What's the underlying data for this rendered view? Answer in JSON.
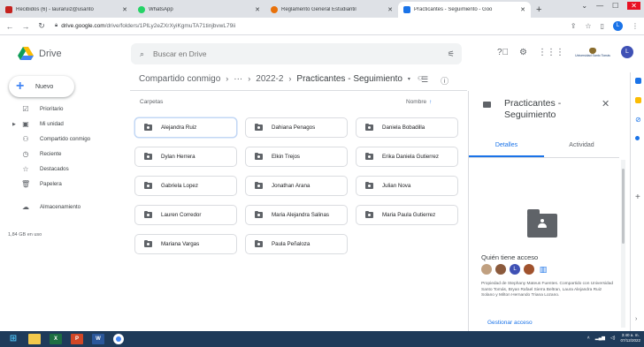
{
  "browser": {
    "tabs": [
      {
        "title": "Recibidos (6) - lauraruiz@usanto",
        "fav": "#c5221f",
        "active": false
      },
      {
        "title": "WhatsApp",
        "fav": "#25d366",
        "active": false
      },
      {
        "title": "Reglamento General Estudiantil",
        "fav": "#e8710a",
        "active": false
      },
      {
        "title": "Practicantes - Seguimiento - Goo",
        "fav": "#1a73e8",
        "active": true
      }
    ],
    "new_tab": "+",
    "url_host": "drive.google.com",
    "url_path": "/drive/folders/1PlLy2eZXrXyiKgmuTA71tinjbvwL79ii",
    "profile_initial": "L"
  },
  "drive": {
    "app_name": "Drive",
    "search_placeholder": "Buscar en Drive",
    "user_initial": "L",
    "org_name": "Universidad Santo Tomás",
    "new_button": "Nuevo",
    "sidebar": {
      "items": [
        {
          "label": "Prioritario",
          "icon": "priority-icon"
        },
        {
          "label": "Mi unidad",
          "icon": "my-drive-icon"
        },
        {
          "label": "Compartido conmigo",
          "icon": "shared-icon"
        },
        {
          "label": "Reciente",
          "icon": "clock-icon"
        },
        {
          "label": "Destacados",
          "icon": "star-icon"
        },
        {
          "label": "Papelera",
          "icon": "trash-icon"
        },
        {
          "label": "Almacenamiento",
          "icon": "cloud-icon"
        }
      ],
      "storage_used": "1,84 GB en uso"
    },
    "breadcrumb": {
      "root": "Compartido conmigo",
      "ellipsis": "···",
      "middle": "2022-2",
      "current": "Practicantes - Seguimiento"
    },
    "section_label": "Carpetas",
    "sort_label": "Nombre",
    "sort_arrow": "↑",
    "folders": [
      "Alejandra Ruiz",
      "Dahiana Penagos",
      "Daniela Bobadilla",
      "Dylan Herrera",
      "Elkin Trejos",
      "Erika Daniela Gutierrez",
      "Gabriela Lopez",
      "Jonathan Arana",
      "Julian Nova",
      "Lauren Corredor",
      "Maria Alejandra Salinas",
      "Maria Paula Gutierrez",
      "Mariana Vargas",
      "Paula Peñaloza"
    ],
    "details": {
      "title": "Practicantes - Seguimiento",
      "tab_details": "Detalles",
      "tab_activity": "Actividad",
      "access_title": "Quién tiene acceso",
      "avatar_initial": "L",
      "access_desc": "Propiedad de Stephany Mateus Fuentes. Compartido con Universidad Santo Tomás, Bryan Rafael Sierra Beltran, Laura Alejandra Ruiz Solano y Milton Hernando Triana Lozano.",
      "manage_button": "Gestionar acceso"
    }
  },
  "taskbar": {
    "time": "3:40 a. m.",
    "date": "07/12/2022"
  }
}
